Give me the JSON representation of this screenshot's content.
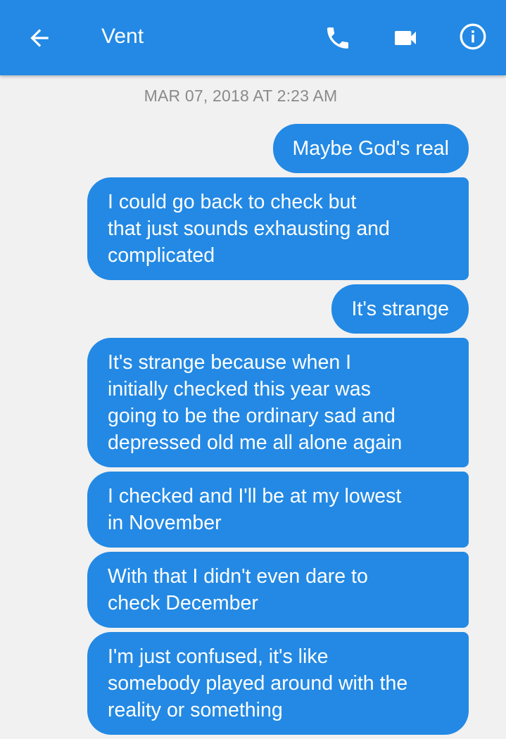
{
  "header": {
    "title": "Vent",
    "icons": {
      "back": "arrow-left-icon",
      "call": "phone-icon",
      "video": "video-camera-icon",
      "info": "info-icon"
    },
    "accent_color": "#2389e4"
  },
  "conversation": {
    "timestamp": "MAR 07, 2018 AT 2:23 AM",
    "messages": [
      {
        "text": "Maybe God's real"
      },
      {
        "text": "I could go back to check but\nthat just sounds exhausting and\ncomplicated"
      },
      {
        "text": "It's strange"
      },
      {
        "text": "It's strange because when I\ninitially checked this year was\ngoing to be the ordinary sad and\ndepressed old me all alone again"
      },
      {
        "text": "I checked and I'll be at my lowest\nin November"
      },
      {
        "text": "With that I didn't even dare to\ncheck December"
      },
      {
        "text": "I'm just confused, it's like\nsomebody played around with the\nreality or something"
      }
    ]
  }
}
